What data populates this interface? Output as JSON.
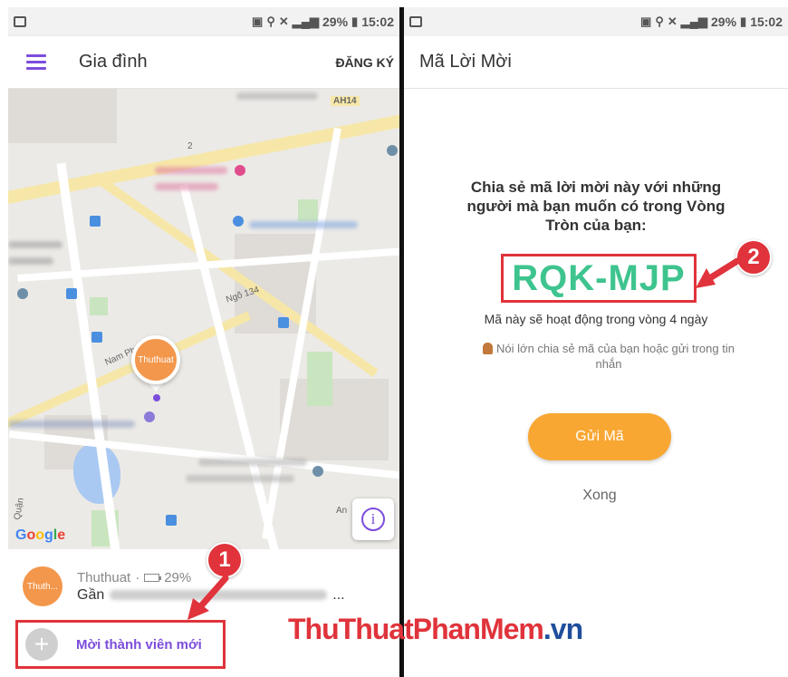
{
  "status_bar": {
    "battery": "29%",
    "time": "15:02"
  },
  "left_screen": {
    "title": "Gia đình",
    "register_label": "ĐĂNG KÝ",
    "map": {
      "road_label_ah14": "AH14",
      "road_label_2": "2",
      "street_ngo": "Ngõ 134",
      "street_nam": "Nam Ph",
      "street_an": "An",
      "street_quan": "Quận",
      "google_logo": "Google",
      "marker_label": "Thuthuat",
      "info_label": "i"
    },
    "member": {
      "avatar_label": "Thuth...",
      "name": "Thuthuat",
      "battery_text": "29%",
      "location_prefix": "Gần",
      "location_suffix": "..."
    },
    "invite_member_label": "Mời thành viên mới",
    "plus_label": "+",
    "step_badge": "1"
  },
  "right_screen": {
    "title": "Mã Lời Mời",
    "share_text": "Chia sẻ mã lời mời này với những người mà bạn muốn có trong Vòng Tròn của bạn:",
    "invite_code": "RQK-MJP",
    "valid_text": "Mã này sẽ hoạt động trong vòng 4 ngày",
    "hint_text": "Nói lớn chia sẻ mã của bạn hoặc gửi trong tin nhắn",
    "send_button": "Gửi Mã",
    "done_button": "Xong",
    "step_badge": "2"
  },
  "watermark": {
    "part1": "ThuThuat",
    "part2": "PhanMem",
    "part3": ".vn"
  },
  "colors": {
    "accent": "#7c4ddc",
    "code_green": "#3ec48e",
    "send_orange": "#f9a733",
    "highlight_red": "#e0333b"
  }
}
